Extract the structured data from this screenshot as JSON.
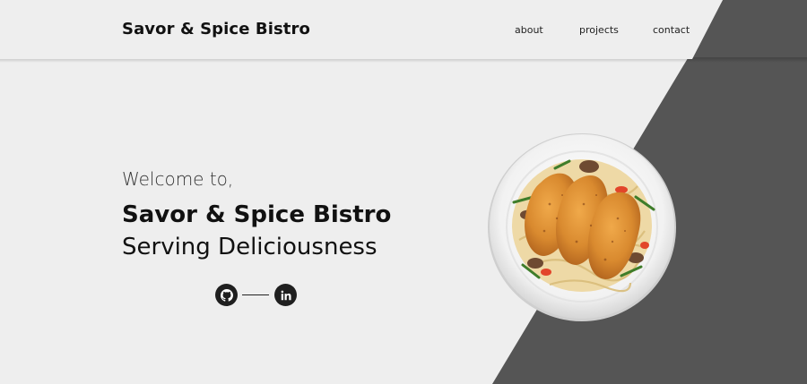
{
  "header": {
    "brand": "Savor & Spice Bistro",
    "nav": [
      {
        "label": "about"
      },
      {
        "label": "projects"
      },
      {
        "label": "contact"
      }
    ]
  },
  "hero": {
    "welcome": "Welcome to,",
    "title": "Savor & Spice Bistro",
    "tagline": "Serving Deliciousness"
  },
  "social": {
    "icons": [
      "github-icon",
      "linkedin-icon"
    ]
  },
  "colors": {
    "background": "#eeeeee",
    "accent_panel": "#555555",
    "icon_bg": "#1f1f1f"
  }
}
